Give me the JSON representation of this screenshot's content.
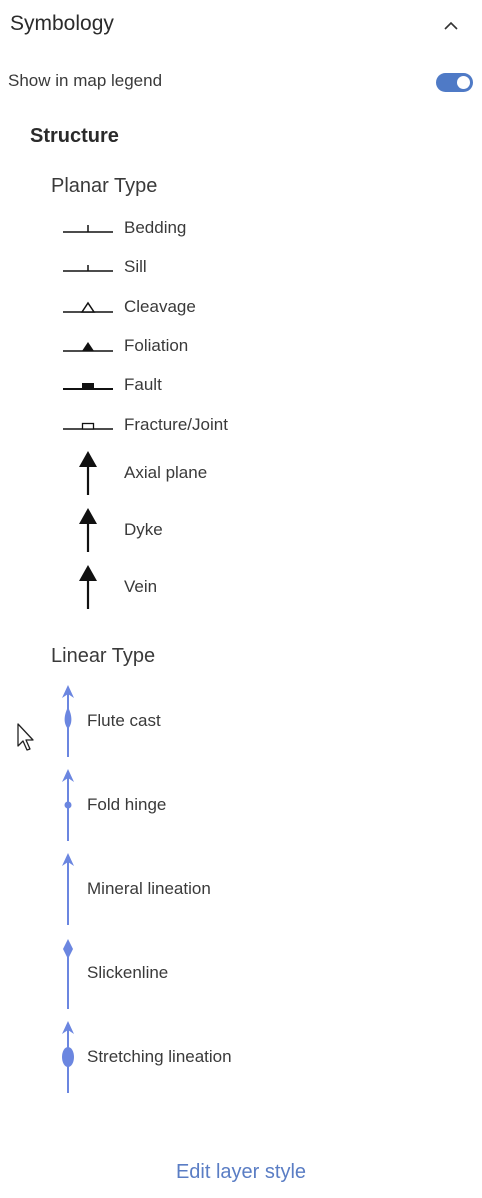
{
  "header": {
    "title": "Symbology"
  },
  "legend_toggle": {
    "label": "Show in map legend",
    "on": true,
    "color": "#4f7ac6"
  },
  "structure": {
    "title": "Structure",
    "planar": {
      "title": "Planar Type",
      "items": [
        {
          "label": "Bedding",
          "icon": "bedding-symbol-icon"
        },
        {
          "label": "Sill",
          "icon": "sill-symbol-icon"
        },
        {
          "label": "Cleavage",
          "icon": "cleavage-symbol-icon"
        },
        {
          "label": "Foliation",
          "icon": "foliation-symbol-icon"
        },
        {
          "label": "Fault",
          "icon": "fault-symbol-icon"
        },
        {
          "label": "Fracture/Joint",
          "icon": "fracture-joint-symbol-icon"
        },
        {
          "label": "Axial plane",
          "icon": "axial-plane-arrow-icon"
        },
        {
          "label": "Dyke",
          "icon": "dyke-arrow-icon"
        },
        {
          "label": "Vein",
          "icon": "vein-arrow-icon"
        }
      ]
    },
    "linear": {
      "title": "Linear Type",
      "color": "#6b86e0",
      "items": [
        {
          "label": "Flute cast",
          "icon": "flute-cast-arrow-icon"
        },
        {
          "label": "Fold hinge",
          "icon": "fold-hinge-arrow-icon"
        },
        {
          "label": "Mineral lineation",
          "icon": "mineral-lineation-arrow-icon"
        },
        {
          "label": "Slickenline",
          "icon": "slickenline-icon"
        },
        {
          "label": "Stretching lineation",
          "icon": "stretching-lineation-arrow-icon"
        }
      ]
    }
  },
  "footer": {
    "edit_link": "Edit layer style"
  }
}
